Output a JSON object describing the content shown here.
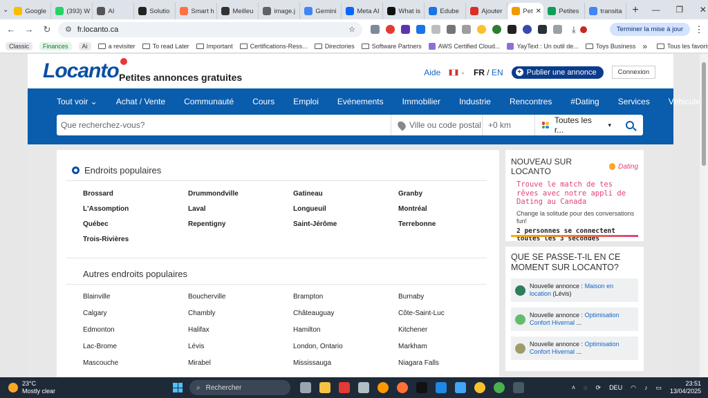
{
  "browser": {
    "tabs": [
      {
        "label": "Google",
        "color": "#fbbc04"
      },
      {
        "label": "(393) W",
        "color": "#25d366"
      },
      {
        "label": "AI",
        "color": "#555555"
      },
      {
        "label": "Solutio",
        "color": "#222222"
      },
      {
        "label": "Smart h",
        "color": "#ff7043"
      },
      {
        "label": "Meilleu",
        "color": "#333333"
      },
      {
        "label": "image.j",
        "color": "#5f6368"
      },
      {
        "label": "Gemini",
        "color": "#4285f4"
      },
      {
        "label": "Meta AI",
        "color": "#0866ff"
      },
      {
        "label": "What is",
        "color": "#111111"
      },
      {
        "label": "Edube",
        "color": "#1a73e8"
      },
      {
        "label": "Ajouter",
        "color": "#d93025"
      },
      {
        "label": "Pet",
        "color": "#f29900",
        "active": true
      },
      {
        "label": "Petites",
        "color": "#0f9d58"
      },
      {
        "label": "transita",
        "color": "#4285f4"
      }
    ],
    "new_tab": "+",
    "url": "fr.locanto.ca",
    "update_button": "Terminer la mise à jour",
    "bookmarks": [
      {
        "label": "Classic",
        "type": "pill"
      },
      {
        "label": "Finances",
        "type": "pill-green"
      },
      {
        "label": "Ai",
        "type": "pill"
      },
      {
        "label": "a revisiter",
        "type": "folder"
      },
      {
        "label": "To read Later",
        "type": "folder"
      },
      {
        "label": "Important",
        "type": "folder"
      },
      {
        "label": "Certifications-Ress...",
        "type": "folder"
      },
      {
        "label": "Directories",
        "type": "folder"
      },
      {
        "label": "Software Partners",
        "type": "folder"
      },
      {
        "label": "AWS Certified Cloud...",
        "type": "site"
      },
      {
        "label": "YayText : Un outil de...",
        "type": "site"
      },
      {
        "label": "Toys Business",
        "type": "folder"
      }
    ],
    "bookmarks_more": "»",
    "all_bookmarks": "Tous les favoris"
  },
  "site": {
    "logo": "Locanto",
    "tagline": "Petites annonces gratuites",
    "help": "Aide",
    "lang_fr": "FR",
    "lang_sep": "/",
    "lang_en": "EN",
    "publish": "Publier une annonce",
    "login": "Connexion",
    "nav": [
      "Tout voir ⌄",
      "Achat / Vente",
      "Communauté",
      "Cours",
      "Emploi",
      "Evénements",
      "Immobilier",
      "Industrie",
      "Rencontres",
      "#Dating",
      "Services",
      "Véhicules"
    ],
    "search": {
      "query_placeholder": "Que recherchez-vous?",
      "location_placeholder": "Ville ou code postal",
      "radius": "+0 km",
      "category": "Toutes les r...",
      "category_caret": "▾"
    }
  },
  "popular": {
    "title": "Endroits populaires",
    "cities": [
      "Brossard",
      "Drummondville",
      "Gatineau",
      "Granby",
      "L'Assomption",
      "Laval",
      "Longueuil",
      "Montréal",
      "Québec",
      "Repentigny",
      "Saint-Jérôme",
      "Terrebonne",
      "Trois-Rivières"
    ]
  },
  "other_popular": {
    "title": "Autres endroits populaires",
    "cities": [
      "Blainville",
      "Boucherville",
      "Brampton",
      "Burnaby",
      "Calgary",
      "Chambly",
      "Châteauguay",
      "Côte-Saint-Luc",
      "Edmonton",
      "Halifax",
      "Hamilton",
      "Kitchener",
      "Lac-Brome",
      "Lévis",
      "London, Ontario",
      "Markham",
      "Mascouche",
      "Mirabel",
      "Mississauga",
      "Niagara Falls"
    ]
  },
  "dating": {
    "heading": "NOUVEAU SUR LOCANTO",
    "logo": "Dating",
    "headline": "Trouve le match de tes rêves avec notre appli de Dating au Canada",
    "subtext": "Change la solitude pour des conversations fun!",
    "stat": "2 personnes se connectent toutes les 3 secondes"
  },
  "live": {
    "title": "QUE SE PASSE-T-IL EN CE MOMENT SUR LOCANTO?",
    "items": [
      {
        "prefix": "Nouvelle annonce : ",
        "link": "Maison en location",
        "suffix": " (Lévis)",
        "color": "#2e7d5b"
      },
      {
        "prefix": "Nouvelle annonce : ",
        "link": "Optimisation Confort Hivernal",
        "suffix": " ...",
        "color": "#66bb6a"
      },
      {
        "prefix": "Nouvelle annonce : ",
        "link": "Optimisation Confort Hivernal",
        "suffix": " ...",
        "color": "#9e9d6a"
      }
    ]
  },
  "taskbar": {
    "temp": "23°C",
    "weather": "Mostly clear",
    "search": "Rechercher",
    "lang": "DEU",
    "time": "23:51",
    "date": "13/04/2025"
  }
}
